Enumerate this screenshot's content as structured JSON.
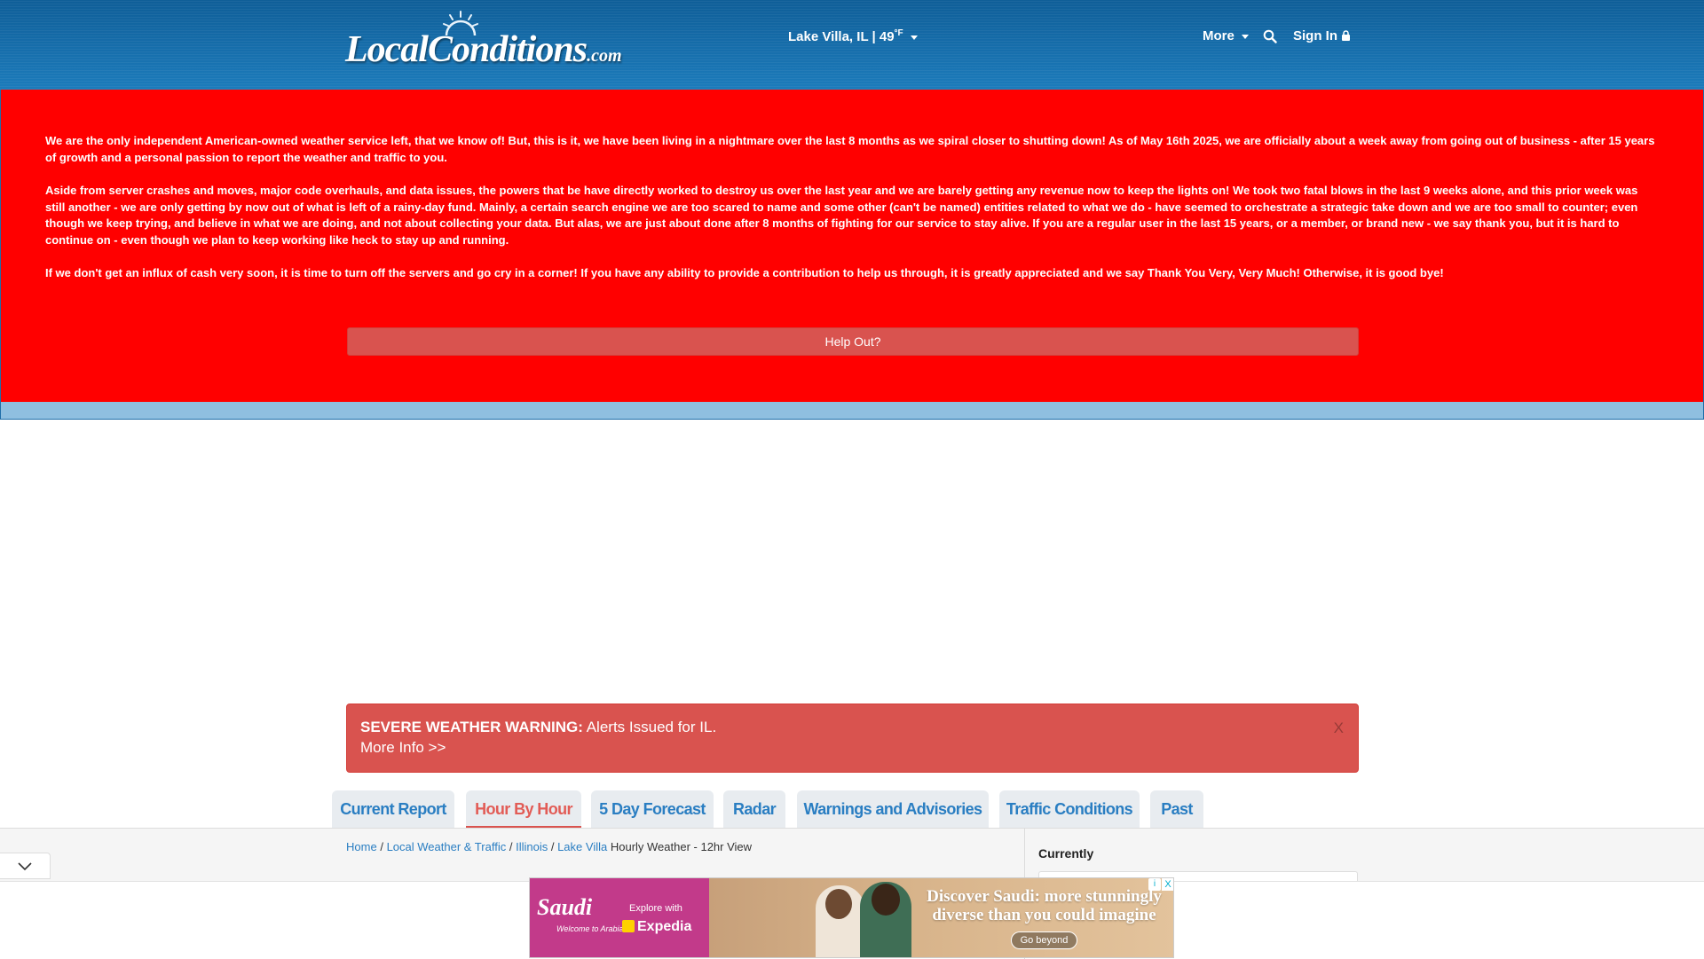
{
  "header": {
    "logo_text": "LocalConditions",
    "logo_suffix": ".com",
    "location": "Lake Villa, IL | 49",
    "temp_unit": "°F",
    "more_label": "More",
    "signin_label": "Sign In"
  },
  "banner": {
    "paragraph1": "We are the only independent American-owned weather service left, that we know of! But, this is it, we have been living in a nightmare over the last 8 months as we spiral closer to shutting down! As of May 16th 2025, we are officially about a week away from going out of business - after 15 years of growth and a personal passion to report the weather and traffic to you.",
    "paragraph2": "Aside from server crashes and moves, major code overhauls, and data issues, the powers that be have directly worked to destroy us over the last year and we are barely getting any revenue now to keep the lights on! We took two fatal blows in the last 9 weeks alone, and this prior week was still another - we are only getting by now out of what is left of a rainy-day fund. Mainly, a certain search engine we are too scared to name and some other (can't be named) entities related to what we do - have seemed to orchestrate a strategic take down and we are too small to counter; even though we keep trying, and believe in what we are doing, and not about collecting your data. But alas, we are just about done after 8 months of fighting for our service to stay alive. If you are a regular user in the last 15 years, or a member, or brand new - we say thank you, but it is hard to continue on - even though we plan to keep working like heck to stay up and running.",
    "paragraph3": "If we don't get an influx of cash very soon, it is time to turn off the servers and go cry in a corner! If you have any ability to provide a contribution to help us through, it is greatly appreciated and we say Thank You Very, Very Much! Otherwise, it is good bye!",
    "help_button": "Help Out?"
  },
  "alert": {
    "title": "SEVERE WEATHER WARNING:",
    "message": "Alerts Issued for IL.",
    "more": "More Info >>",
    "close": "X"
  },
  "tabs": [
    {
      "label": "Current Report",
      "active": false
    },
    {
      "label": "Hour By Hour",
      "active": true
    },
    {
      "label": "5 Day Forecast",
      "active": false
    },
    {
      "label": "Radar",
      "active": false
    },
    {
      "label": "Warnings and Advisories",
      "active": false
    },
    {
      "label": "Traffic Conditions",
      "active": false
    },
    {
      "label": "Past",
      "active": false
    }
  ],
  "breadcrumb": {
    "items": [
      "Home",
      "Local Weather & Traffic",
      "Illinois",
      "Lake Villa"
    ],
    "separator": "/",
    "current": "Hourly Weather - 12hr View"
  },
  "sidebar": {
    "currently_label": "Currently"
  },
  "ad": {
    "brand": "Saudi",
    "welcome": "Welcome to Arabia",
    "explore": "Explore with",
    "partner": "Expedia",
    "headline": "Discover Saudi: more stunningly diverse than you could imagine",
    "cta": "Go beyond",
    "info_label": "i",
    "close_label": "X"
  },
  "colors": {
    "header_blue": "#1b72b0",
    "banner_red": "#ff0000",
    "alert_red": "#d9534f",
    "link_blue": "#2a7ec2",
    "active_tab": "#e25c56"
  }
}
